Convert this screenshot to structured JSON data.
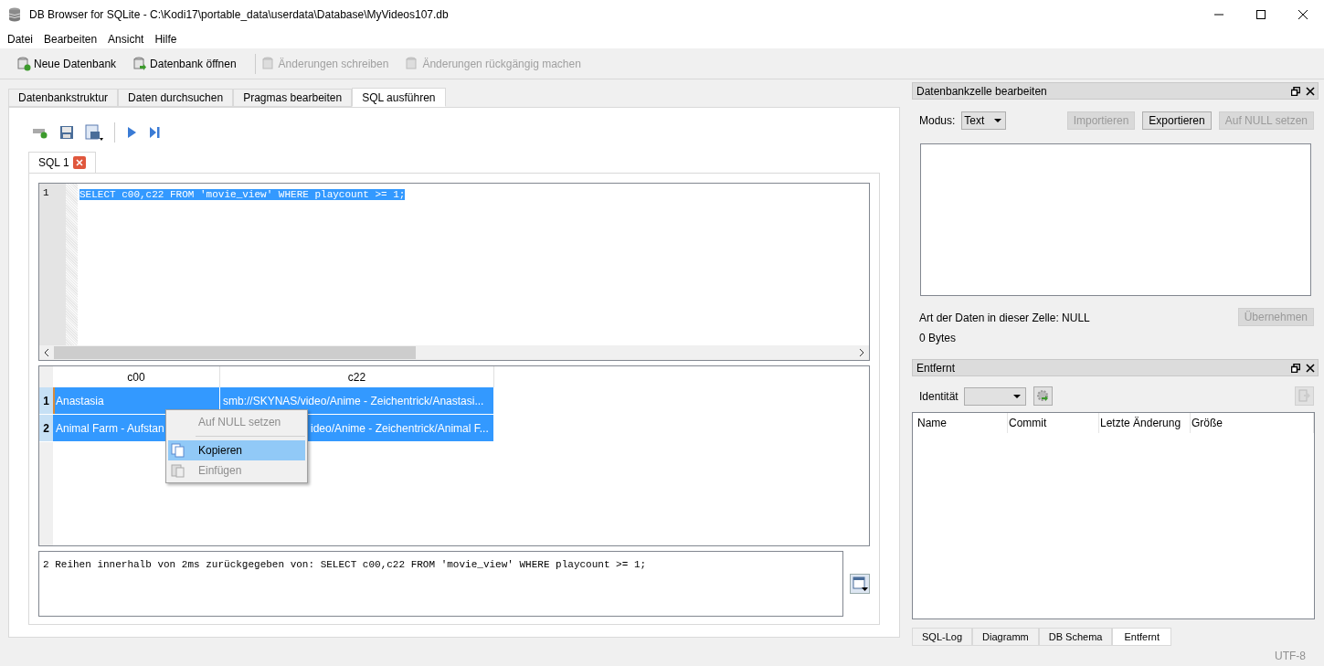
{
  "window": {
    "title": "DB Browser for SQLite - C:\\Kodi17\\portable_data\\userdata\\Database\\MyVideos107.db"
  },
  "menu": [
    "Datei",
    "Bearbeiten",
    "Ansicht",
    "Hilfe"
  ],
  "toolbar": [
    {
      "label": "Neue Datenbank",
      "disabled": false
    },
    {
      "label": "Datenbank öffnen",
      "disabled": false
    },
    {
      "label": "Änderungen schreiben",
      "disabled": true
    },
    {
      "label": "Änderungen rückgängig machen",
      "disabled": true
    }
  ],
  "main_tabs": [
    {
      "label": "Datenbankstruktur",
      "selected": false
    },
    {
      "label": "Daten durchsuchen",
      "selected": false
    },
    {
      "label": "Pragmas bearbeiten",
      "selected": false
    },
    {
      "label": "SQL ausführen",
      "selected": true
    }
  ],
  "editor_tabs": [
    {
      "label": "SQL 1",
      "selected": true
    }
  ],
  "editor": {
    "line_numbers": [
      "1"
    ],
    "code": "SELECT c00,c22 FROM 'movie_view' WHERE playcount >= 1;"
  },
  "results": {
    "columns": [
      "c00",
      "c22"
    ],
    "rows": [
      {
        "number": "1",
        "selected": true,
        "cells": [
          "Anastasia",
          "smb://SKYNAS/video/Anime - Zeichentrick/Anastasi..."
        ]
      },
      {
        "number": "2",
        "selected": true,
        "cells": [
          "Animal Farm - Aufstan",
          "ideo/Anime - Zeichentrick/Animal F..."
        ]
      }
    ]
  },
  "context_menu": [
    {
      "label": "Auf NULL setzen",
      "disabled": true,
      "selected": false,
      "kind": "plain"
    },
    {
      "label": "Kopieren",
      "disabled": false,
      "selected": true,
      "kind": "copy"
    },
    {
      "label": "Einfügen",
      "disabled": true,
      "selected": false,
      "kind": "paste"
    }
  ],
  "log": "2 Reihen innerhalb von 2ms zurückgegeben von: SELECT c00,c22 FROM 'movie_view' WHERE playcount >= 1;",
  "edit_cell": {
    "title": "Datenbankzelle bearbeiten",
    "mode_label": "Modus:",
    "mode": "Text",
    "buttons": [
      {
        "label": "Importieren",
        "disabled": true
      },
      {
        "label": "Exportieren",
        "disabled": false
      },
      {
        "label": "Auf NULL setzen",
        "disabled": true
      }
    ],
    "type_info": "Art der Daten in dieser Zelle: NULL",
    "size": "0 Bytes",
    "apply": {
      "label": "Übernehmen",
      "disabled": true
    }
  },
  "remote": {
    "title": "Entfernt",
    "identity_label": "Identität",
    "columns": [
      "Name",
      "Commit",
      "Letzte Änderung",
      "Größe"
    ]
  },
  "dock_tabs": [
    {
      "label": "SQL-Log",
      "selected": false
    },
    {
      "label": "Diagramm",
      "selected": false
    },
    {
      "label": "DB Schema",
      "selected": false
    },
    {
      "label": "Entfernt",
      "selected": true
    }
  ],
  "status_bar": {
    "encoding": "UTF-8"
  }
}
